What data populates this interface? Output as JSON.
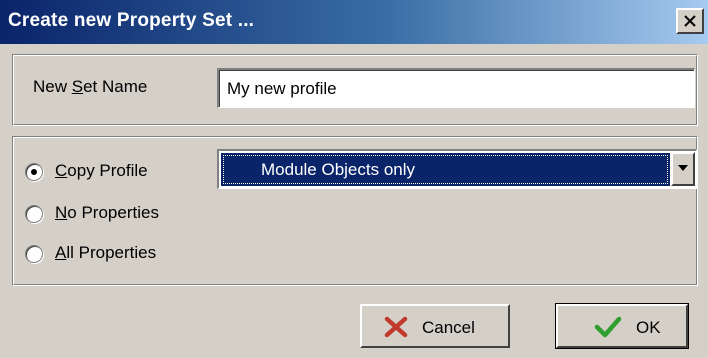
{
  "dialog": {
    "title": "Create new Property Set ...",
    "close_label": "Close"
  },
  "name_section": {
    "label": {
      "prefix": "New ",
      "accel": "S",
      "suffix": "et Name"
    },
    "value": "My new profile"
  },
  "options": [
    {
      "accel": "C",
      "rest": "opy Profile",
      "checked": true
    },
    {
      "accel": "N",
      "rest": "o Properties",
      "checked": false
    },
    {
      "accel": "A",
      "rest": "ll Properties",
      "checked": false
    }
  ],
  "profile_dropdown": {
    "selected": "Module Objects only"
  },
  "buttons": {
    "cancel": "Cancel",
    "ok": "OK"
  },
  "colors": {
    "titlebar_start": "#0a246a",
    "face": "#d4d0c8",
    "selection": "#0a246a",
    "cancel_icon": "#c0392b",
    "ok_icon": "#2e9e2e"
  },
  "icons": {
    "close": "close-icon",
    "dropdown": "chevron-down-icon",
    "cancel": "red-x-icon",
    "ok": "green-check-icon"
  }
}
